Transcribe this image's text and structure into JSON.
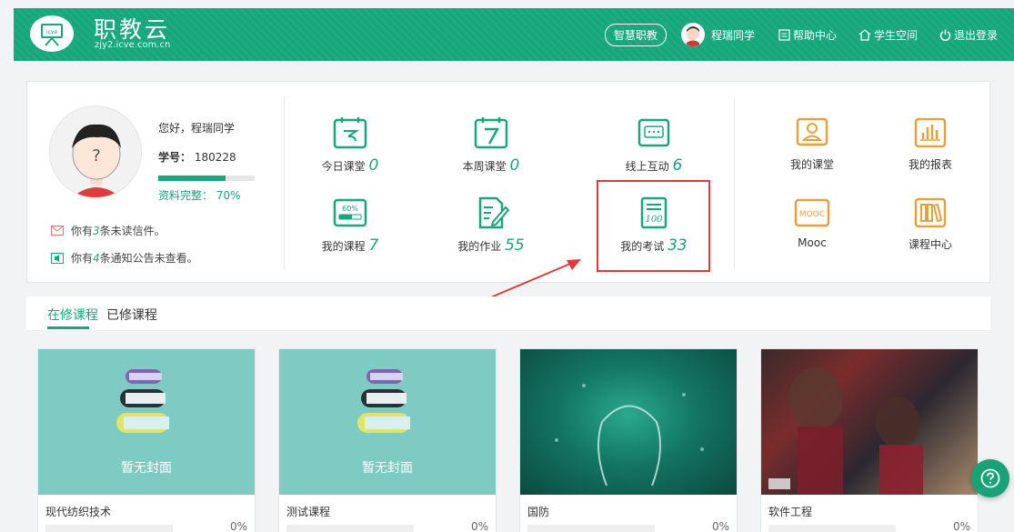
{
  "header": {
    "brand": "职教云",
    "domain": "zjy2.icve.com.cn",
    "logo_text": "icve",
    "nav_button": "智慧职教",
    "user_name": "程瑞同学",
    "help_center": "帮助中心",
    "student_space": "学生空间",
    "logout": "退出登录"
  },
  "profile": {
    "greeting": "您好，程瑞同学",
    "id_label": "学号：",
    "id_value": "180228",
    "completeness_label": "资料完整：",
    "completeness_value": "70%",
    "completeness": 0.7,
    "unread_prefix": "你有",
    "unread_count": "3",
    "unread_suffix": "条未读信件。",
    "notice_prefix": "你有",
    "notice_count": "4",
    "notice_suffix": "条通知公告未查看。"
  },
  "tiles": {
    "today": {
      "label": "今日课堂",
      "count": "0"
    },
    "week": {
      "label": "本周课堂",
      "count": "0"
    },
    "online": {
      "label": "线上互动",
      "count": "6"
    },
    "courses": {
      "label": "我的课程",
      "count": "7"
    },
    "homework": {
      "label": "我的作业",
      "count": "55"
    },
    "exams": {
      "label": "我的考试",
      "count": "33"
    },
    "my_class": {
      "label": "我的课堂"
    },
    "reports": {
      "label": "我的报表"
    },
    "mooc": {
      "label": "Mooc",
      "badge": "MOOC"
    },
    "course_center": {
      "label": "课程中心"
    }
  },
  "tabs": {
    "current": "在修课程",
    "completed": "已修课程"
  },
  "cards": [
    {
      "title": "现代纺织技术",
      "cover_text": "暂无封面",
      "progress": "0%"
    },
    {
      "title": "测试课程",
      "cover_text": "暂无封面",
      "progress": "0%"
    },
    {
      "title": "国防",
      "progress": "0%"
    },
    {
      "title": "软件工程",
      "progress": "0%"
    }
  ],
  "colors": {
    "primary": "#16a77a",
    "accent_orange": "#e8a13a",
    "highlight_red": "#e53935"
  }
}
